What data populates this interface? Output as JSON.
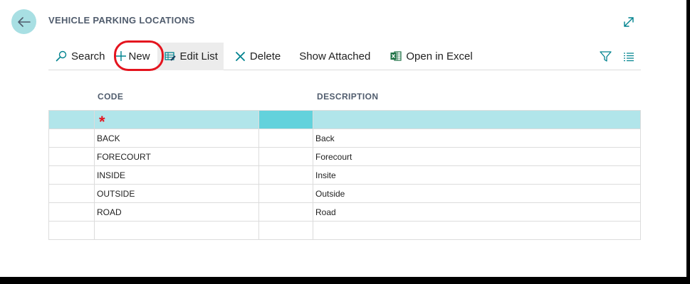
{
  "page": {
    "title": "VEHICLE PARKING LOCATIONS"
  },
  "actions": {
    "search": "Search",
    "new": "New",
    "edit_list": "Edit List",
    "delete": "Delete",
    "show_attached": "Show Attached",
    "open_in_excel": "Open in Excel"
  },
  "icons": {
    "back": "back-arrow-icon",
    "expand": "expand-icon",
    "search": "search-icon",
    "new": "plus-icon",
    "edit_list": "edit-list-icon",
    "delete": "delete-x-icon",
    "excel": "excel-icon",
    "filter": "filter-icon",
    "list": "list-view-icon"
  },
  "columns": {
    "code": "CODE",
    "description": "DESCRIPTION"
  },
  "new_row_marker": "*",
  "rows": [
    {
      "code": "BACK",
      "description": "Back"
    },
    {
      "code": "FORECOURT",
      "description": "Forecourt"
    },
    {
      "code": "INSIDE",
      "description": "Insite"
    },
    {
      "code": "OUTSIDE",
      "description": "Outside"
    },
    {
      "code": "ROAD",
      "description": "Road"
    },
    {
      "code": "",
      "description": ""
    }
  ],
  "colors": {
    "accent": "#00838f",
    "selected_row": "#b1e5ea",
    "selected_cell": "#63d2dc",
    "highlight": "#e4141e",
    "excel_green": "#1e7145"
  }
}
